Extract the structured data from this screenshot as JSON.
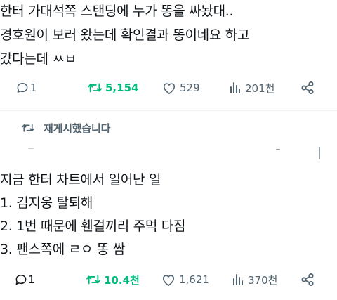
{
  "tweet1": {
    "lines": [
      "한터 가대석쪽 스탠딩에 누가 똥을 싸놨대..",
      "경호원이 보러 왔는데 확인결과 똥이네요 하고",
      "갔다는데 ㅆㅂ"
    ],
    "actions": {
      "reply_count": "1",
      "retweet_count": "5,154",
      "like_count": "529",
      "view_count": "201천"
    }
  },
  "retweet_note": {
    "label": "재게시했습니다"
  },
  "tweet2": {
    "lines": [
      "지금 한터 차트에서 일어난 일",
      "1. 김지웅 탈퇴해",
      "2. 1번 때문에 휀걸끼리 주먹 다짐",
      "3. 팬스쪽에 ㄹㅇ 똥 쌈"
    ],
    "actions": {
      "reply_count": "1",
      "retweet_count": "10.4천",
      "like_count": "1,621",
      "view_count": "370천"
    }
  },
  "colors": {
    "text": "#0f1419",
    "muted": "#536471",
    "retweet_active": "#00ba7c",
    "divider": "#eff3f4"
  },
  "icons": [
    "reply-icon",
    "retweet-icon",
    "like-icon",
    "views-icon",
    "share-icon",
    "more-icon"
  ]
}
